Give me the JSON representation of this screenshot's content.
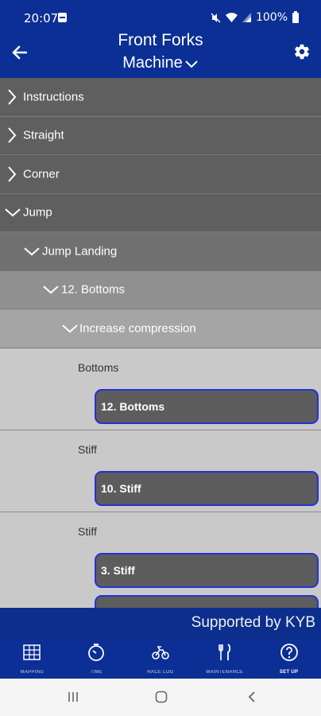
{
  "status_bar": {
    "time": "20:07",
    "battery": "100%"
  },
  "header": {
    "title": "Front Forks",
    "subtitle": "Machine"
  },
  "tree": {
    "items": [
      {
        "label": "Instructions",
        "expanded": false
      },
      {
        "label": "Straight",
        "expanded": false
      },
      {
        "label": "Corner",
        "expanded": false
      },
      {
        "label": "Jump",
        "expanded": true
      },
      {
        "label": "Jump Landing",
        "expanded": true
      },
      {
        "label": "12. Bottoms",
        "expanded": true
      },
      {
        "label": "Increase compression",
        "expanded": true
      }
    ],
    "sections": [
      {
        "heading": "Bottoms",
        "buttons": [
          "12. Bottoms"
        ]
      },
      {
        "heading": "Stiff",
        "buttons": [
          "10. Stiff"
        ]
      },
      {
        "heading": "Stiff",
        "buttons": [
          "3. Stiff",
          ""
        ]
      }
    ]
  },
  "banner": {
    "text": "Supported by KYB"
  },
  "bottom_nav": {
    "items": [
      {
        "label": "MAPPING",
        "icon": "grid-icon"
      },
      {
        "label": "TIME",
        "icon": "stopwatch-icon"
      },
      {
        "label": "RACE LOG",
        "icon": "motorbike-icon"
      },
      {
        "label": "MAINTENANCE",
        "icon": "fork-knife-icon"
      },
      {
        "label": "SET UP",
        "icon": "help-circle-icon",
        "active": true
      }
    ]
  },
  "colors": {
    "primary": "#0b2f94",
    "accent_border": "#2233d6"
  }
}
